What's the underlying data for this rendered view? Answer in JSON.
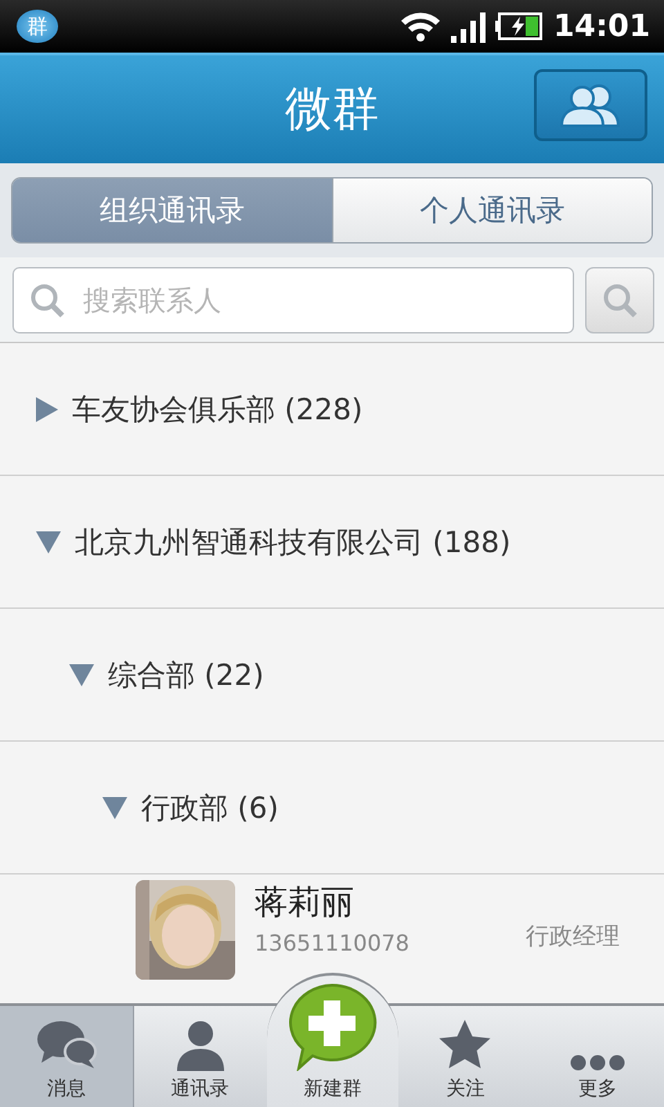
{
  "status_bar": {
    "app_badge": "群",
    "time": "14:01"
  },
  "header": {
    "title": "微群"
  },
  "tabs": [
    {
      "label": "组织通讯录",
      "selected": true
    },
    {
      "label": "个人通讯录",
      "selected": false
    }
  ],
  "search": {
    "placeholder": "搜索联系人"
  },
  "tree": [
    {
      "kind": "group",
      "label": "车友协会俱乐部 (228)",
      "expanded": false
    },
    {
      "kind": "group",
      "label": "北京九州智通科技有限公司 (188)",
      "expanded": true,
      "children": [
        {
          "kind": "group",
          "label": "综合部 (22)",
          "expanded": true,
          "children": [
            {
              "kind": "group",
              "label": "行政部 (6)",
              "expanded": true,
              "children": [
                {
                  "kind": "contact",
                  "name": "蒋莉丽",
                  "phone": "13651110078",
                  "title": "行政经理"
                }
              ]
            }
          ]
        }
      ]
    }
  ],
  "nav": [
    {
      "kind": "messages",
      "label": "消息",
      "selected": true
    },
    {
      "kind": "contacts",
      "label": "通讯录",
      "selected": false
    },
    {
      "kind": "new",
      "label": "新建群",
      "selected": false
    },
    {
      "kind": "follow",
      "label": "关注",
      "selected": false
    },
    {
      "kind": "more",
      "label": "更多",
      "selected": false
    }
  ]
}
